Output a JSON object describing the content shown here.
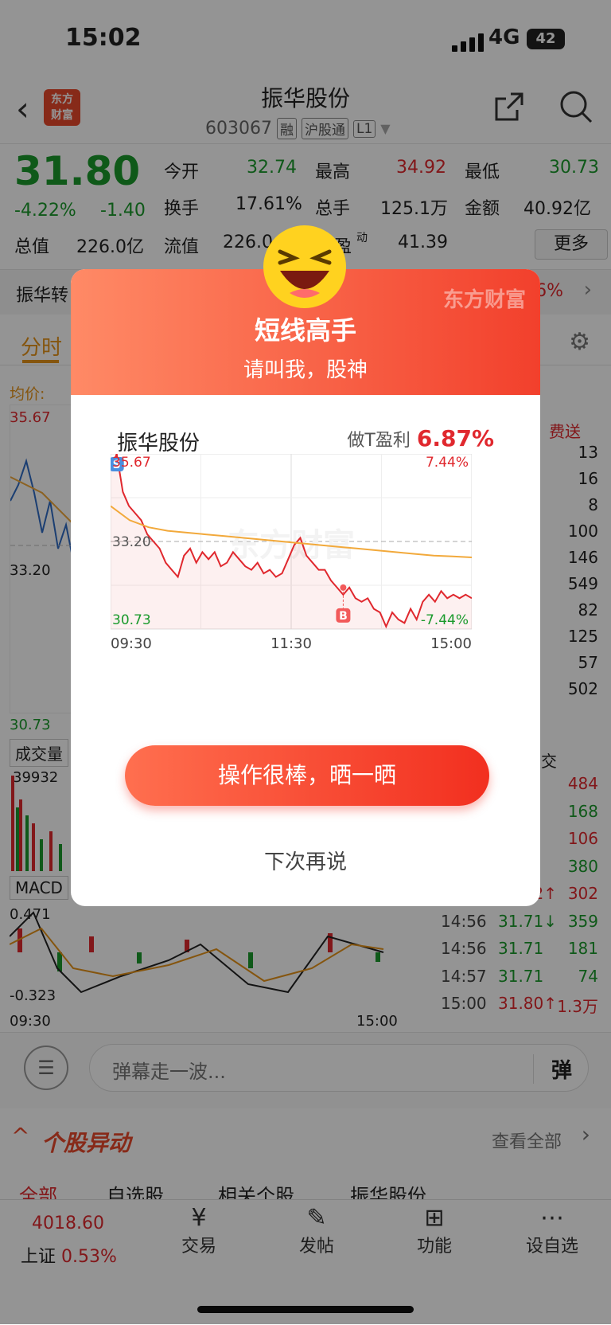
{
  "status": {
    "time": "15:02",
    "network": "4G",
    "battery": "42"
  },
  "header": {
    "stock_name": "振华股份",
    "logo_text": "东方\n财富",
    "code": "603067",
    "tags": [
      "融",
      "沪股通",
      "L1"
    ]
  },
  "quote": {
    "price": "31.80",
    "change_pct": "-4.22%",
    "change": "-1.40",
    "open_label": "今开",
    "open": "32.74",
    "high_label": "最高",
    "high": "34.92",
    "low_label": "最低",
    "low": "30.73",
    "turnover_label": "换手",
    "turnover": "17.61%",
    "volume_label": "总手",
    "volume": "125.1万",
    "amount_label": "金额",
    "amount": "40.92亿",
    "mcap_label": "总值",
    "mcap": "226.0亿",
    "float_label": "流值",
    "float_val": "226.0",
    "pe_label": "盈",
    "pe_sup": "动",
    "pe": "41.39",
    "more": "更多"
  },
  "banner": {
    "left": "振华转",
    "right": "6%"
  },
  "tabs": {
    "active": "分时"
  },
  "bg_chart": {
    "avg_label": "均价:",
    "top": "35.67",
    "mid": "33.20",
    "bottom": "30.73",
    "vol_label": "成交量",
    "vol_max": "39932",
    "macd_label": "MACD",
    "macd_top": "0.471",
    "macd_bottom": "-0.323",
    "t_start": "09:30",
    "t_end": "15:00",
    "free_badge": "费送"
  },
  "side_top": [
    "13",
    "16",
    "8",
    "100",
    "146",
    "549",
    "82",
    "125",
    "57",
    "502"
  ],
  "side_head": "交",
  "side_trades": [
    {
      "t": "",
      "p": "",
      "v": "484",
      "c": "red"
    },
    {
      "t": "",
      "p": "",
      "v": "168",
      "c": "green"
    },
    {
      "t": "",
      "p": "↑",
      "v": "106",
      "c": "red"
    },
    {
      "t": "",
      "p": "↓",
      "v": "380",
      "c": "green"
    },
    {
      "t": "14:56",
      "p": "31.72↑",
      "v": "302",
      "c": "red"
    },
    {
      "t": "14:56",
      "p": "31.71↓",
      "v": "359",
      "c": "green"
    },
    {
      "t": "14:56",
      "p": "31.71",
      "v": "181",
      "c": "green"
    },
    {
      "t": "14:57",
      "p": "31.71",
      "v": "74",
      "c": "green"
    },
    {
      "t": "15:00",
      "p": "31.80↑",
      "v": "1.3万",
      "c": "red"
    }
  ],
  "danmaku": {
    "placeholder": "弹幕走一波...",
    "btn": "弹"
  },
  "movement": {
    "title": "个股异动",
    "see_all": "查看全部",
    "tabs": [
      "全部",
      "自选股",
      "相关个股",
      "振华股份"
    ]
  },
  "modal": {
    "brand": "东方财富",
    "title": "短线高手",
    "subtitle": "请叫我，股神",
    "stock": "振华股份",
    "profit_label": "做T盈利",
    "profit": "6.87%",
    "chart": {
      "top": "35.67",
      "mid": "33.20",
      "bottom": "30.73",
      "top_pct": "7.44%",
      "bottom_pct": "-7.44%",
      "times": [
        "09:30",
        "11:30",
        "15:00"
      ],
      "buy": "B",
      "sell": "S",
      "watermark": "东方财富"
    },
    "share": "操作很棒，晒一晒",
    "later": "下次再说"
  },
  "chart_data": {
    "type": "line",
    "x": [
      "09:30",
      "11:30",
      "15:00"
    ],
    "ylim": [
      30.73,
      35.67
    ],
    "series": [
      {
        "name": "",
        "color": "#e0282e",
        "values": [
          35.2,
          35.67,
          34.6,
          34.2,
          34.0,
          33.8,
          33.4,
          33.2,
          33.0,
          32.6,
          32.4,
          32.2,
          32.8,
          33.0,
          32.6,
          32.9,
          32.7,
          32.9,
          32.5,
          32.6,
          32.9,
          32.7,
          32.5,
          32.4,
          32.6,
          32.3,
          32.4,
          32.2,
          32.3,
          32.7,
          33.1,
          33.3,
          32.8,
          32.6,
          32.4,
          32.4,
          32.1,
          31.9,
          31.7,
          31.9,
          31.6,
          31.5,
          31.6,
          31.3,
          31.2,
          30.8,
          31.2,
          31.0,
          30.9,
          31.3,
          31.0,
          31.5,
          31.7,
          31.5,
          31.8,
          31.6,
          31.7,
          31.6,
          31.7,
          31.6
        ]
      },
      {
        "name": "",
        "color": "#f2a93b",
        "values": [
          34.2,
          33.8,
          33.6,
          33.5,
          33.45,
          33.4,
          33.35,
          33.3,
          33.25,
          33.2,
          33.15,
          33.1,
          33.05,
          33.0,
          32.95,
          32.9,
          32.85,
          32.8,
          32.78,
          32.75
        ]
      }
    ],
    "markers": [
      {
        "label": "S",
        "x_index": 1,
        "value": 35.3
      },
      {
        "label": "B",
        "x_index": 38,
        "value": 31.9
      }
    ]
  }
}
